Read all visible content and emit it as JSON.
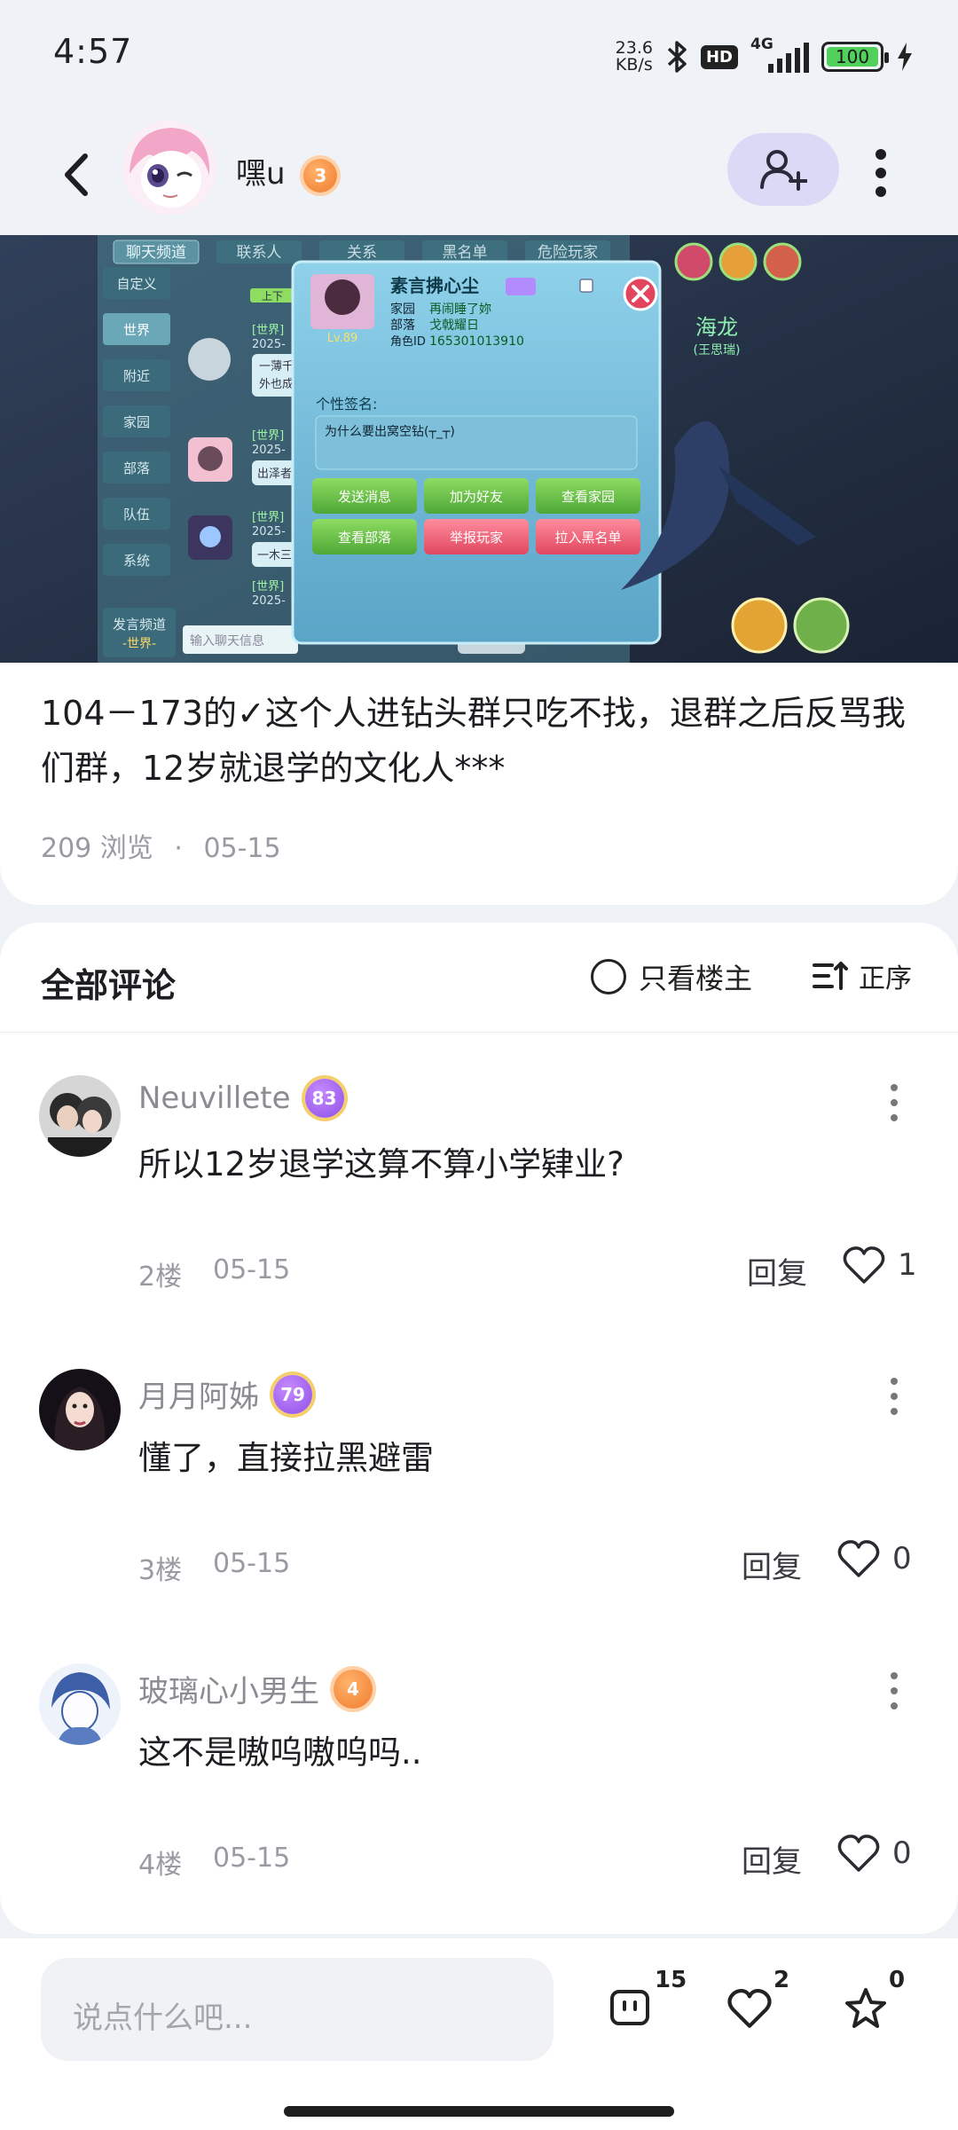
{
  "status_bar": {
    "time": "4:57",
    "net_speed_value": "23.6",
    "net_speed_unit": "KB/s",
    "hd_badge": "HD",
    "signal_label": "4G",
    "battery": "100"
  },
  "header": {
    "author_name": "嘿u",
    "author_level": "3"
  },
  "post": {
    "text": "104－173的✓这个人进钻头群只吃不找，退群之后反骂我们群，12岁就退学的文化人***",
    "views": "209 浏览",
    "separator": "·",
    "date": "05-15",
    "screenshot": {
      "tabs": [
        "聊天频道",
        "联系人",
        "关系",
        "黑名单",
        "危险玩家"
      ],
      "channels": [
        "自定义",
        "世界",
        "附近",
        "家园",
        "部落",
        "队伍",
        "系统"
      ],
      "send_channel": "发言频道",
      "send_channel_sub": "-世界-",
      "chat_placeholder": "输入聊天信息",
      "profile_name": "素言拂心尘",
      "profile_level": "Lv.89",
      "home_label": "家园",
      "home_value": "再闹睡了妳",
      "tribe_label": "部落",
      "tribe_value": "戈戟耀日",
      "role_label": "角色ID",
      "role_value": "165301013910",
      "signature_label": "个性签名:",
      "signature_text": "为什么要出窝空钻(┬_┬)",
      "buttons": [
        "发送消息",
        "加为好友",
        "查看家园",
        "查看部落",
        "举报玩家",
        "拉入黑名单"
      ],
      "npc_name": "海龙",
      "npc_sub": "(王思瑞)",
      "chat_tag": "[世界]",
      "chat_year": "2025-",
      "chat_snippet_1": "一薄千",
      "chat_snippet_2": "外也成",
      "chat_snippet_3": "出泽者",
      "chat_snippet_4": "一木三",
      "chat_up": "上下"
    }
  },
  "comments": {
    "title": "全部评论",
    "only_owner": "只看楼主",
    "order": "正序",
    "reply_label": "回复",
    "items": [
      {
        "name": "Neuvillete",
        "level": "83",
        "text": "所以12岁退学这算不算小学肄业?",
        "floor": "2楼",
        "date": "05-15",
        "likes": "1"
      },
      {
        "name": "月月阿姊",
        "level": "79",
        "text": "懂了，直接拉黑避雷",
        "floor": "3楼",
        "date": "05-15",
        "likes": "0"
      },
      {
        "name": "玻璃心小男生",
        "level": "4",
        "text": "这不是嗷呜嗷呜吗..",
        "floor": "4楼",
        "date": "05-15",
        "likes": "0"
      }
    ]
  },
  "bottom_bar": {
    "placeholder": "说点什么吧...",
    "comment_count": "15",
    "like_count": "2",
    "fav_count": "0"
  }
}
